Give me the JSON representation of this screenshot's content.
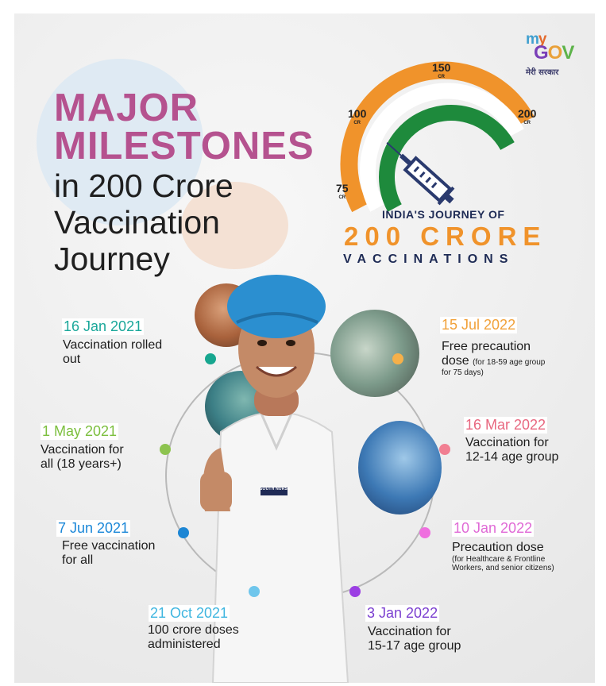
{
  "logo": {
    "my": [
      "m",
      "y"
    ],
    "gov": [
      "G",
      "O",
      "V"
    ],
    "subtitle": "मेरी सरकार"
  },
  "heading": {
    "line1": "MAJOR",
    "line2": "MILESTONES",
    "sub1": "in 200 Crore",
    "sub2": "Vaccination",
    "sub3": "Journey"
  },
  "gauge": {
    "ticks": [
      {
        "value": "75",
        "unit": "CR"
      },
      {
        "value": "100",
        "unit": "CR"
      },
      {
        "value": "150",
        "unit": "CR"
      },
      {
        "value": "200",
        "unit": "CR"
      }
    ],
    "title": "INDIA'S JOURNEY OF",
    "big_a": "200 CR",
    "big_o": "O",
    "big_b": "RE",
    "subtitle": "VACCINATIONS",
    "colors": {
      "saffron": "#f0932b",
      "white": "#ffffff",
      "green": "#1e8a3c",
      "navy": "#2a3a6e"
    }
  },
  "milestones": [
    {
      "date": "16 Jan 2021",
      "desc": [
        "Vaccination rolled",
        "out"
      ],
      "color": "#1aa79a",
      "dot": "#17a68f"
    },
    {
      "date": "1 May 2021",
      "desc": [
        "Vaccination for",
        "all (18 years+)"
      ],
      "color": "#7cbf3e",
      "dot": "#8dc34f"
    },
    {
      "date": "7 Jun 2021",
      "desc": [
        "Free vaccination",
        "for all"
      ],
      "color": "#1a87d8",
      "dot": "#1d86d4"
    },
    {
      "date": "21 Oct 2021",
      "desc": [
        "100 crore doses",
        "administered"
      ],
      "color": "#3fb6e0",
      "dot": "#6fc6ec"
    },
    {
      "date": "3 Jan 2022",
      "desc": [
        "Vaccination for",
        "15-17 age group"
      ],
      "color": "#7b3fd0",
      "dot": "#9b3fe3"
    },
    {
      "date": "10 Jan 2022",
      "desc": [
        "Precaution dose"
      ],
      "note": [
        "(for Healthcare & Frontline",
        "Workers, and senior citizens)"
      ],
      "color": "#e06ad6",
      "dot": "#ef6fdf"
    },
    {
      "date": "16 Mar 2022",
      "desc": [
        "Vaccination for",
        "12-14 age group"
      ],
      "color": "#e8677f",
      "dot": "#f17f92"
    },
    {
      "date": "15 Jul 2022",
      "desc": [
        "Free precaution"
      ],
      "desc2": "dose",
      "note_inline": "(for 18-59 age group",
      "note_line": "for 75 days)",
      "color": "#f1a13a",
      "dot": "#f6b04a"
    }
  ],
  "badge": "SOUTH NURSE"
}
